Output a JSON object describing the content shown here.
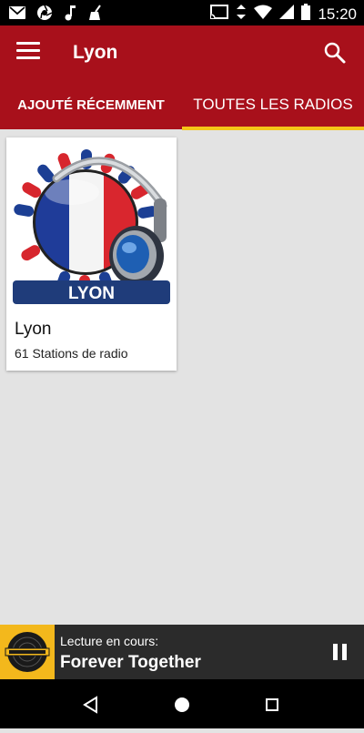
{
  "status_bar": {
    "time": "15:20",
    "left_icons": [
      "mail-icon",
      "aperture-icon",
      "music-note-icon",
      "broom-icon"
    ],
    "right_icons": [
      "cast-icon",
      "vibrate-icon",
      "wifi-icon",
      "signal-icon",
      "battery-icon"
    ]
  },
  "app_bar": {
    "title": "Lyon",
    "menu_icon": "hamburger-menu-icon",
    "search_icon": "search-icon",
    "color": "#a8101b"
  },
  "tabs": [
    {
      "label": "AJOUTÉ RÉCEMMENT",
      "selected": false
    },
    {
      "label": "TOUTES LES RADIOS",
      "selected": true
    }
  ],
  "accent": "#f5c518",
  "cards": [
    {
      "title": "Lyon",
      "subtitle": "61 Stations de radio",
      "image_banner": "LYON"
    }
  ],
  "now_playing": {
    "label": "Lecture en cours:",
    "track": "Forever Together",
    "control_icon": "pause-icon"
  },
  "nav_bar": {
    "icons": [
      "back-icon",
      "home-icon",
      "recents-icon"
    ]
  }
}
